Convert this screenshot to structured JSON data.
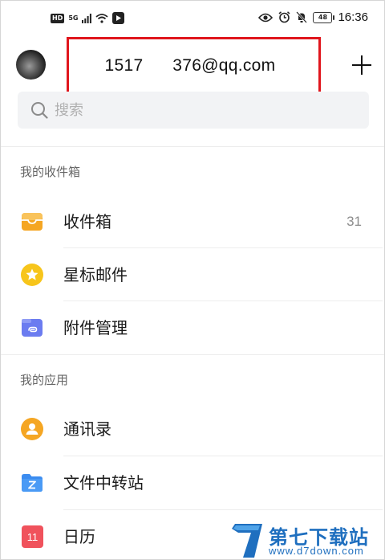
{
  "status_bar": {
    "left_badges": [
      "HD",
      "5G"
    ],
    "battery": "48",
    "time": "16:36"
  },
  "header": {
    "account": "1517      376@qq.com",
    "add_icon": "plus-icon"
  },
  "search": {
    "placeholder": "搜索",
    "icon": "search-icon"
  },
  "sections": [
    {
      "title": "我的收件箱",
      "items": [
        {
          "label": "收件箱",
          "count": "31",
          "icon": "inbox-icon",
          "color": "#f5a623"
        },
        {
          "label": "星标邮件",
          "count": "",
          "icon": "star-icon",
          "color": "#f7c51b"
        },
        {
          "label": "附件管理",
          "count": "",
          "icon": "attachment-icon",
          "color": "#6b7cf0"
        }
      ]
    },
    {
      "title": "我的应用",
      "items": [
        {
          "label": "通讯录",
          "icon": "contacts-icon",
          "color": "#f5a623"
        },
        {
          "label": "文件中转站",
          "icon": "folder-icon",
          "color": "#3b8cf0"
        },
        {
          "label": "日历",
          "icon": "calendar-icon",
          "color": "#f0525c",
          "badge": "11"
        }
      ]
    }
  ],
  "watermark": {
    "name": "第七下载站",
    "url": "www.d7down.com"
  },
  "colors": {
    "highlight_box": "#e0161d",
    "watermark": "#1f6fbf"
  }
}
